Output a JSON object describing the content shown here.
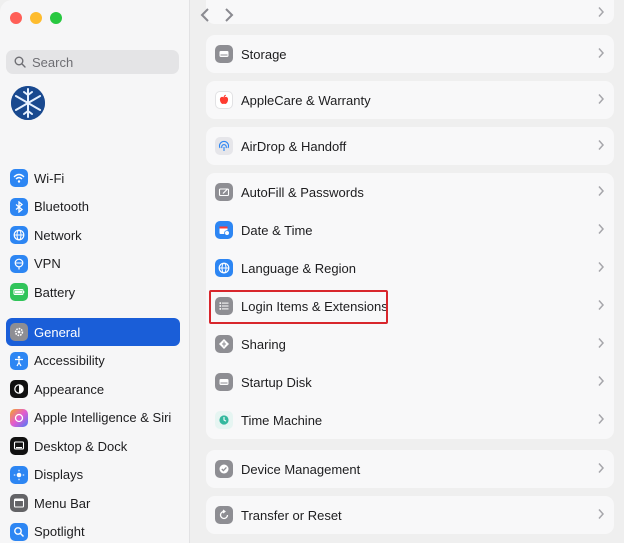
{
  "sidebar": {
    "search_placeholder": "Search",
    "items": [
      {
        "label": "Wi-Fi",
        "icon": "wifi-icon",
        "color": "#2d86f3"
      },
      {
        "label": "Bluetooth",
        "icon": "bluetooth-icon",
        "color": "#2d86f3"
      },
      {
        "label": "Network",
        "icon": "globe-icon",
        "color": "#2d86f3"
      },
      {
        "label": "VPN",
        "icon": "vpn-globe-icon",
        "color": "#2d86f3"
      },
      {
        "label": "Battery",
        "icon": "battery-icon",
        "color": "#31c45a"
      },
      {
        "label": "General",
        "icon": "gear-icon",
        "color": "#8e8e93",
        "active": true
      },
      {
        "label": "Accessibility",
        "icon": "accessibility-icon",
        "color": "#2d86f3"
      },
      {
        "label": "Appearance",
        "icon": "appearance-icon",
        "color": "#111111"
      },
      {
        "label": "Apple Intelligence & Siri",
        "icon": "siri-icon",
        "color": "#e35ad1"
      },
      {
        "label": "Desktop & Dock",
        "icon": "dock-icon",
        "color": "#111111"
      },
      {
        "label": "Displays",
        "icon": "sun-icon",
        "color": "#2d86f3"
      },
      {
        "label": "Menu Bar",
        "icon": "menu-bar-icon",
        "color": "#636366"
      },
      {
        "label": "Spotlight",
        "icon": "magnifier-icon",
        "color": "#2d86f3"
      }
    ]
  },
  "content": {
    "groups": [
      {
        "rows": [
          {
            "label": "Storage",
            "icon": "storage-icon",
            "color": "#8e8e93"
          }
        ]
      },
      {
        "rows": [
          {
            "label": "AppleCare & Warranty",
            "icon": "applecare-icon",
            "color": "#ff3b30"
          }
        ]
      },
      {
        "rows": [
          {
            "label": "AirDrop & Handoff",
            "icon": "airdrop-icon",
            "color": "#e6e6ea"
          }
        ]
      },
      {
        "rows": [
          {
            "label": "AutoFill & Passwords",
            "icon": "autofill-icon",
            "color": "#8e8e93"
          },
          {
            "label": "Date & Time",
            "icon": "calendar-clock-icon",
            "color": "#2d86f3"
          },
          {
            "label": "Language & Region",
            "icon": "globe-icon",
            "color": "#2d86f3"
          },
          {
            "label": "Login Items & Extensions",
            "icon": "list-icon",
            "color": "#8e8e93",
            "highlighted": true
          },
          {
            "label": "Sharing",
            "icon": "sharing-icon",
            "color": "#8e8e93"
          },
          {
            "label": "Startup Disk",
            "icon": "disk-icon",
            "color": "#8e8e93"
          },
          {
            "label": "Time Machine",
            "icon": "time-machine-icon",
            "color": "#e6f5f2"
          }
        ]
      },
      {
        "rows": [
          {
            "label": "Device Management",
            "icon": "device-management-icon",
            "color": "#8e8e93"
          }
        ]
      },
      {
        "rows": [
          {
            "label": "Transfer or Reset",
            "icon": "reset-icon",
            "color": "#8e8e93"
          }
        ]
      }
    ]
  },
  "colors": {
    "accent": "#1a5ed8",
    "highlight": "#d8262c",
    "close": "#ff5f57",
    "minimize": "#febc2e",
    "zoom": "#28c840"
  }
}
